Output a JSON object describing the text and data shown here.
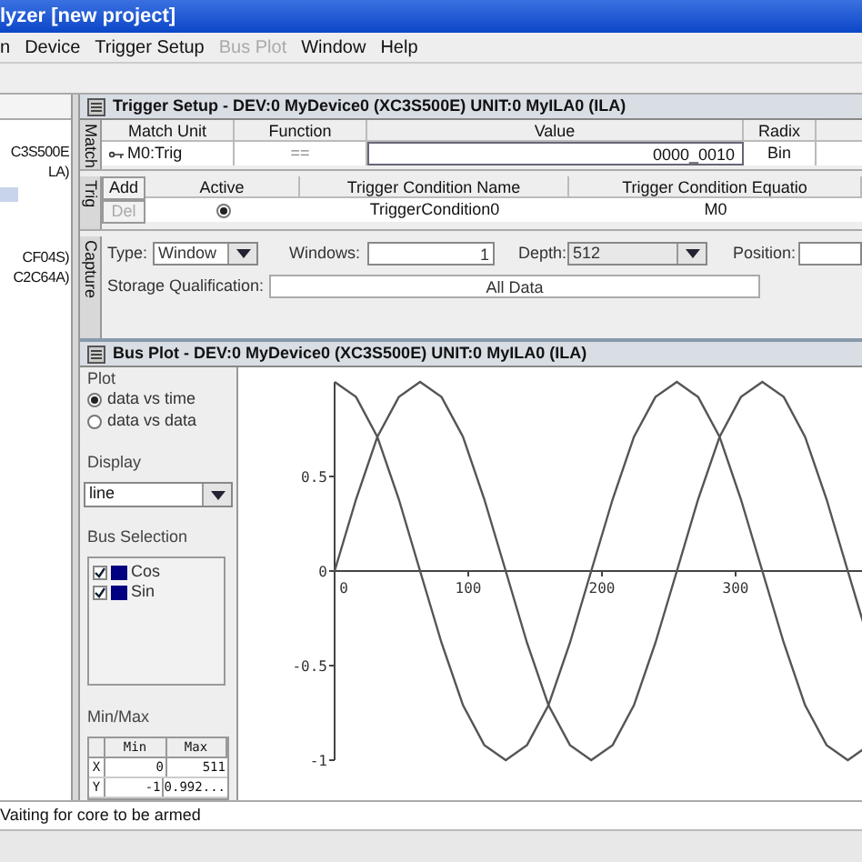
{
  "window": {
    "title": "lyzer [new project]"
  },
  "menu": [
    {
      "label": "n",
      "disabled": false
    },
    {
      "label": "Device",
      "disabled": false
    },
    {
      "label": "Trigger Setup",
      "disabled": false
    },
    {
      "label": "Bus Plot",
      "disabled": true
    },
    {
      "label": "Window",
      "disabled": false
    },
    {
      "label": "Help",
      "disabled": false
    }
  ],
  "project_tree": {
    "items": [
      {
        "label": "C3S500E"
      },
      {
        "label": "LA)"
      },
      {
        "label": "CF04S)"
      },
      {
        "label": "C2C64A)"
      }
    ]
  },
  "trigger_setup": {
    "title": "Trigger Setup - DEV:0 MyDevice0 (XC3S500E) UNIT:0 MyILA0 (ILA)",
    "match": {
      "tab": "Match",
      "columns": [
        "Match Unit",
        "Function",
        "Value",
        "Radix"
      ],
      "rows": [
        {
          "match_unit": "M0:Trig",
          "function": "==",
          "value": "0000_0010",
          "radix": "Bin"
        }
      ]
    },
    "trig": {
      "tab": "Trig",
      "buttons": [
        {
          "label": "Add",
          "disabled": false
        },
        {
          "label": "Del",
          "disabled": true
        }
      ],
      "columns": [
        "Active",
        "Trigger Condition Name",
        "Trigger Condition Equatio"
      ],
      "rows": [
        {
          "active": true,
          "name": "TriggerCondition0",
          "equation": "M0"
        }
      ]
    },
    "capture": {
      "tab": "Capture",
      "type_label": "Type:",
      "type_value": "Window",
      "windows_label": "Windows:",
      "windows_value": "1",
      "depth_label": "Depth:",
      "depth_value": "512",
      "position_label": "Position:",
      "storage_label": "Storage Qualification:",
      "storage_value": "All Data"
    }
  },
  "bus_plot": {
    "title": "Bus Plot - DEV:0 MyDevice0 (XC3S500E) UNIT:0 MyILA0 (ILA)",
    "plot_group": "Plot",
    "plot_options": [
      {
        "label": "data vs time",
        "selected": true
      },
      {
        "label": "data vs data",
        "selected": false
      }
    ],
    "display_group": "Display",
    "display_value": "line",
    "bus_group": "Bus Selection",
    "buses": [
      {
        "checked": true
      },
      {
        "checked": true
      }
    ],
    "minmax_group": "Min/Max",
    "minmax": {
      "columns": [
        "Min",
        "Max"
      ],
      "rows": [
        {
          "axis": "X",
          "min": "0",
          "max": "511"
        },
        {
          "axis": "Y",
          "min": "-1",
          "max": "0.992..."
        }
      ]
    },
    "chart_data": {
      "type": "line",
      "xlim": [
        0,
        400
      ],
      "ylim": [
        -1,
        1
      ],
      "xticks": [
        0,
        100,
        200,
        300
      ],
      "yticks": [
        {
          "value": 0.5,
          "label": "0.5"
        },
        {
          "value": 0,
          "label": "0"
        },
        {
          "value": -0.5,
          "label": "-0.5"
        },
        {
          "value": -1,
          "label": "-1"
        }
      ],
      "x": [
        0,
        16,
        32,
        48,
        64,
        80,
        96,
        112,
        128,
        144,
        160,
        176,
        192,
        208,
        224,
        240,
        256,
        272,
        288,
        304,
        320,
        336,
        352,
        368,
        384,
        400
      ],
      "series": [
        {
          "name": "Cos",
          "color": "#555555",
          "values": [
            1,
            0.92,
            0.71,
            0.38,
            0,
            -0.38,
            -0.71,
            -0.92,
            -1,
            -0.92,
            -0.71,
            -0.38,
            0,
            0.38,
            0.71,
            0.92,
            1,
            0.92,
            0.71,
            0.38,
            0,
            -0.38,
            -0.71,
            -0.92,
            -1,
            -0.92
          ]
        },
        {
          "name": "Sin",
          "color": "#555555",
          "values": [
            0,
            0.38,
            0.71,
            0.92,
            1,
            0.92,
            0.71,
            0.38,
            0,
            -0.38,
            -0.71,
            -0.92,
            -1,
            -0.92,
            -0.71,
            -0.38,
            0,
            0.38,
            0.71,
            0.92,
            1,
            0.92,
            0.71,
            0.38,
            0,
            -0.38
          ]
        }
      ]
    }
  },
  "status_bar": {
    "message": "Vaiting for core to be armed"
  }
}
